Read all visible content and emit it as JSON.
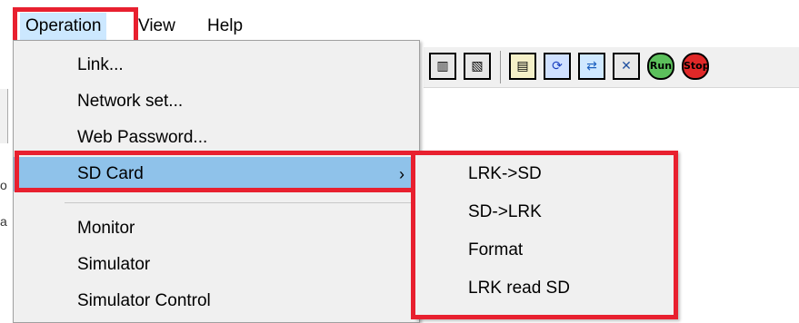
{
  "menubar": {
    "items": [
      {
        "label": "Operation"
      },
      {
        "label": "View"
      },
      {
        "label": "Help"
      }
    ]
  },
  "operation_menu": {
    "items": [
      {
        "label": "Link..."
      },
      {
        "label": "Network set..."
      },
      {
        "label": "Web Password..."
      },
      {
        "label": "SD Card",
        "has_submenu": true
      },
      {
        "label": "Monitor"
      },
      {
        "label": "Simulator"
      },
      {
        "label": "Simulator Control"
      }
    ],
    "submenu_arrow": "›"
  },
  "sd_card_submenu": {
    "items": [
      {
        "label": "LRK->SD"
      },
      {
        "label": "SD->LRK"
      },
      {
        "label": "Format"
      },
      {
        "label": "LRK read SD"
      }
    ]
  },
  "toolbar": {
    "icons": [
      "io-icon",
      "io-view-icon",
      "monitor-icon",
      "refresh-icon",
      "sync-icon",
      "tools-icon",
      "run-icon",
      "stop-icon"
    ],
    "run_label": "Run",
    "stop_label": "Stop"
  },
  "colors": {
    "highlight_box": "#e8202f",
    "active_item": "#8fc2ea",
    "menubar_open": "#cce8ff"
  }
}
